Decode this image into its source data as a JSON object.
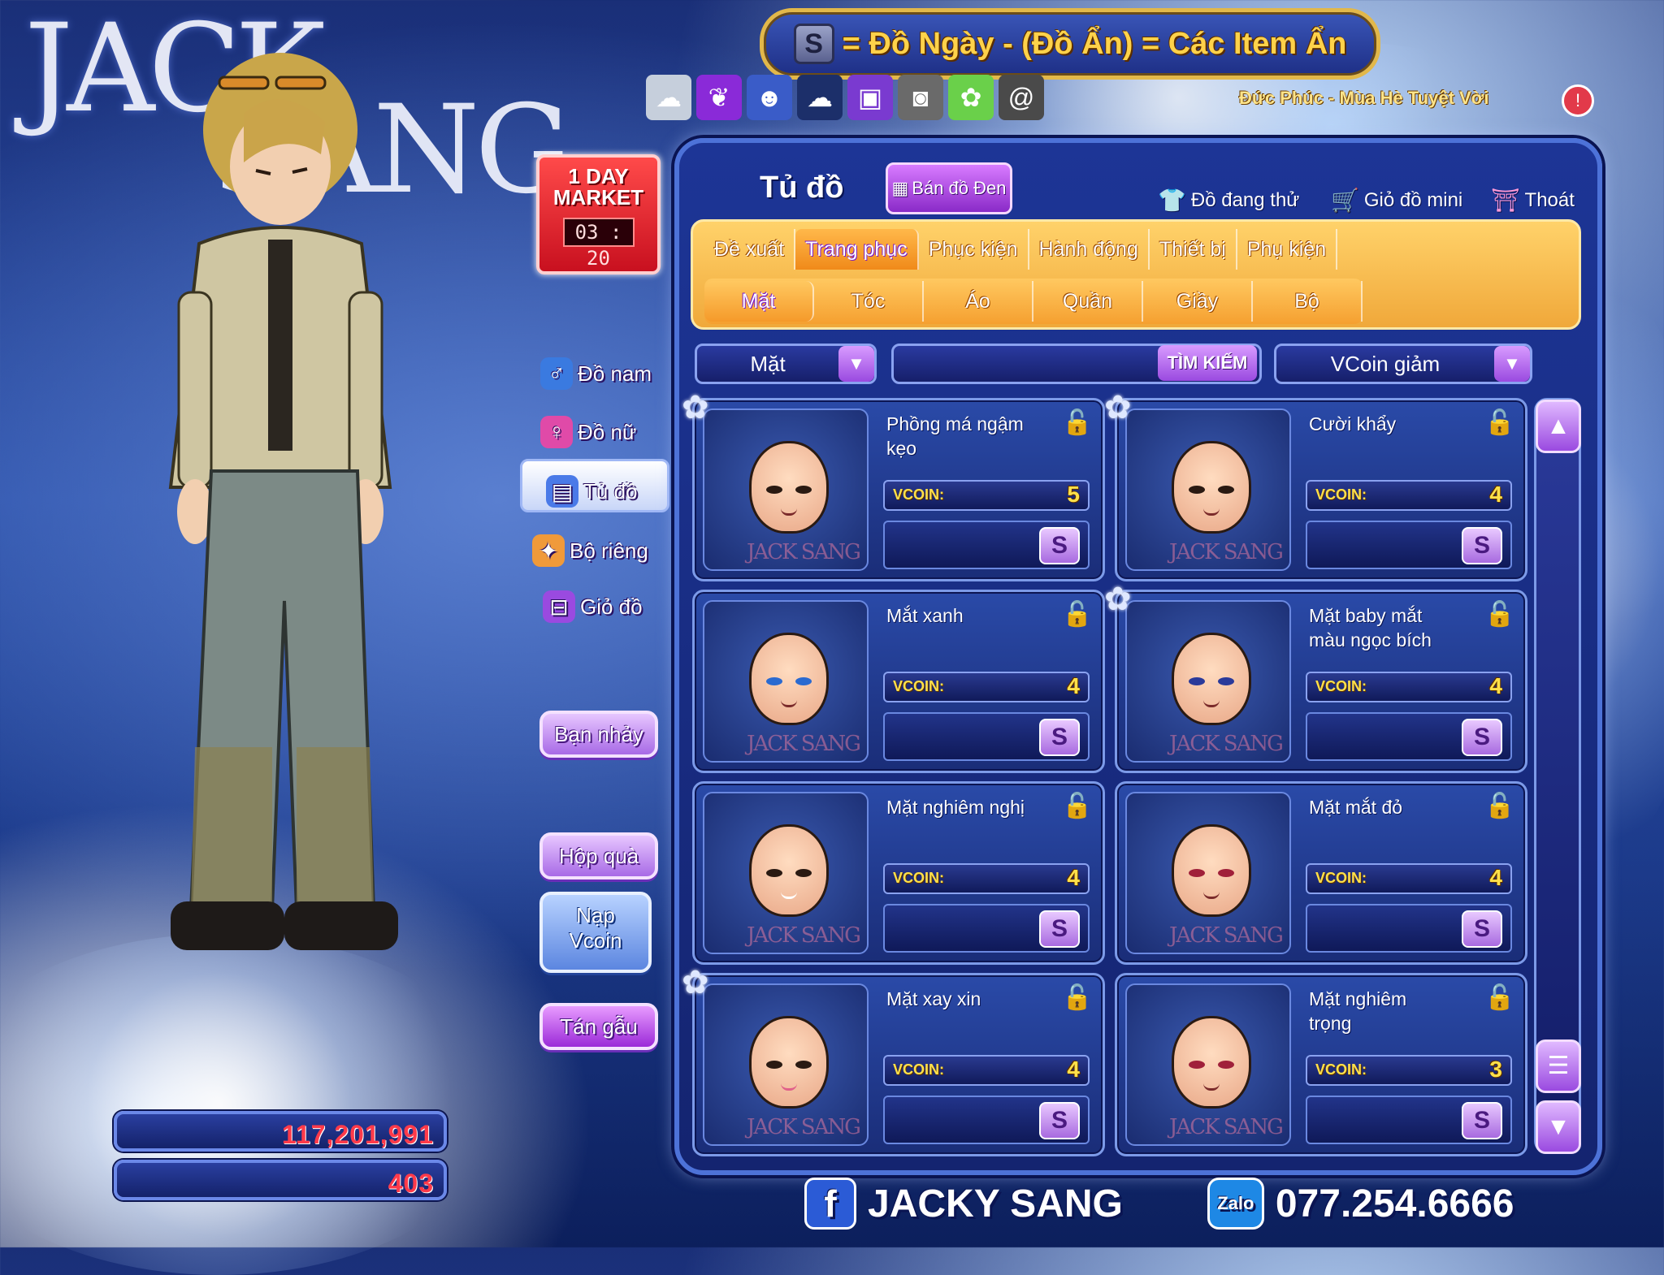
{
  "watermark": {
    "line1": "JACK",
    "line2": "SANG"
  },
  "banner": {
    "s_icon": "S",
    "text": "= Đồ Ngày - (Đồ Ẩn) = Các Item Ẩn"
  },
  "icon_strip": [
    "cloud-icon",
    "feather-icon",
    "owl-icon",
    "dark-cloud-icon",
    "tv-icon",
    "photo-icon",
    "garden-icon",
    "snail-icon"
  ],
  "signature": "Đức Phúc - Mùa Hè Tuyệt Vời",
  "market": {
    "title_line1": "1 DAY",
    "title_line2": "MARKET",
    "timer": "03 : 20"
  },
  "side_menu": {
    "men": "Đồ nam",
    "women": "Đồ nữ",
    "wardrobe": "Tủ đồ",
    "private_set": "Bộ riêng",
    "basket": "Giỏ đồ"
  },
  "buttons": {
    "dance_partner": "Bạn nhảy",
    "gift_box": "Hộp quà",
    "topup_line1": "Nạp",
    "topup_line2": "Vcoin",
    "chat": "Tán gẫu"
  },
  "currency": {
    "gold": "117,201,991",
    "vcoin": "403"
  },
  "panel": {
    "title": "Tủ đồ",
    "black_map": "Bán đồ Đen",
    "trying_on": "Đồ đang thử",
    "mini_basket": "Giỏ đồ mini",
    "exit": "Thoát"
  },
  "tabs": [
    "Đề xuất",
    "Trang phục",
    "Phục kiện",
    "Hành động",
    "Thiết bị",
    "Phụ kiện"
  ],
  "active_tab": "Trang phục",
  "subtabs": [
    "Mặt",
    "Tóc",
    "Áo",
    "Quần",
    "Giầy",
    "Bộ"
  ],
  "filters": {
    "category": "Mặt",
    "search_button": "TÌM KIẾM",
    "sort": "VCoin giảm"
  },
  "items": [
    {
      "name": "Phồng má ngậm kẹo",
      "vcoin_label": "VCOIN:",
      "price": "5",
      "s": "S"
    },
    {
      "name": "Cười khẩy",
      "vcoin_label": "VCOIN:",
      "price": "4",
      "s": "S"
    },
    {
      "name": "Mắt xanh",
      "vcoin_label": "VCOIN:",
      "price": "4",
      "s": "S"
    },
    {
      "name": "Mặt baby mắt màu ngọc bích",
      "vcoin_label": "VCOIN:",
      "price": "4",
      "s": "S"
    },
    {
      "name": "Mặt nghiêm nghị",
      "vcoin_label": "VCOIN:",
      "price": "4",
      "s": "S"
    },
    {
      "name": "Mặt mắt đỏ",
      "vcoin_label": "VCOIN:",
      "price": "4",
      "s": "S"
    },
    {
      "name": "Mặt xay xin",
      "vcoin_label": "VCOIN:",
      "price": "4",
      "s": "S"
    },
    {
      "name": "Mặt nghiêm trọng",
      "vcoin_label": "VCOIN:",
      "price": "3",
      "s": "S"
    }
  ],
  "item_watermark": "JACK SANG",
  "footer": {
    "fb": "f",
    "fb_name": "JACKY SANG",
    "zalo": "Zalo",
    "phone": "077.254.6666"
  },
  "colors": {
    "accent_gold": "#ffd24a",
    "panel_blue": "#1d3596",
    "tab_orange": "#f0a83a",
    "price_yellow": "#ffe04a",
    "money_red": "#ff3a4a"
  }
}
